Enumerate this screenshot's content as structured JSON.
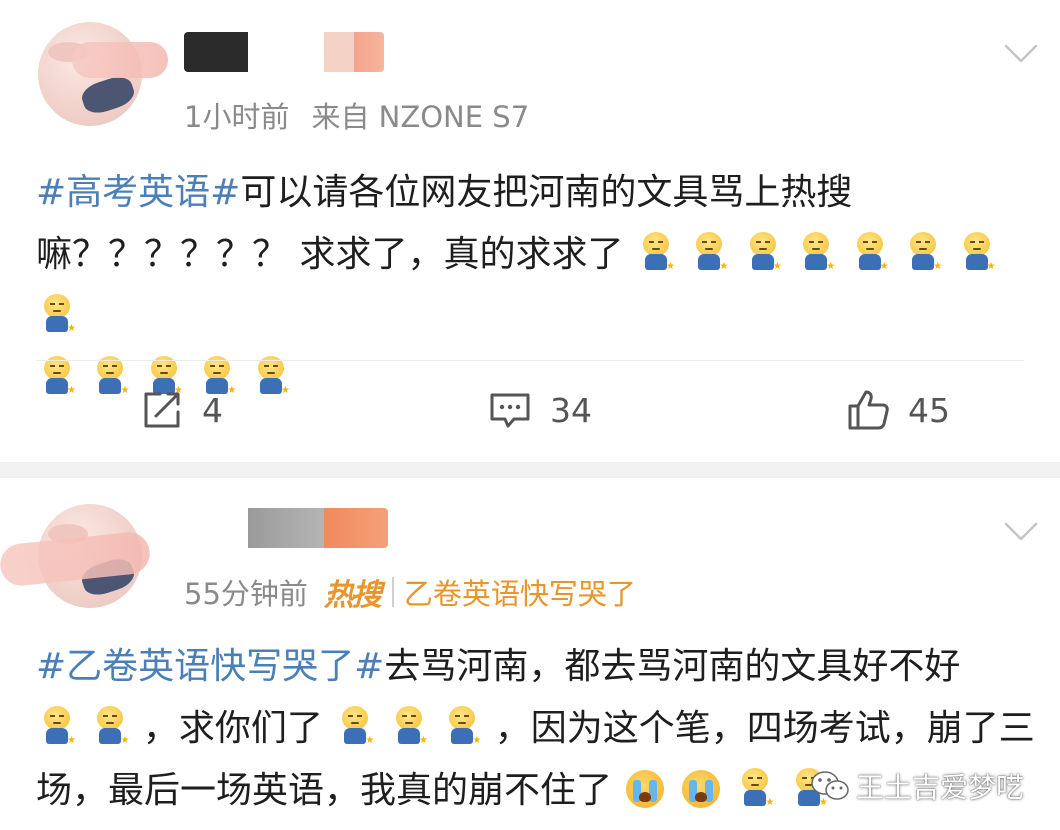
{
  "posts": [
    {
      "time": "1小时前",
      "source": "来自 NZONE S7",
      "topic": "#高考英语#",
      "text_line1": "可以请各位网友把河南的文具骂上热搜",
      "text_line2": "嘛？？？？？？ 求求了，真的求求了",
      "emoji_icon": "sweat-face-emoji",
      "actions": {
        "repost_count": "4",
        "comment_count": "34",
        "like_count": "45"
      }
    },
    {
      "time": "55分钟前",
      "hot_badge": "热搜",
      "hot_topic": "乙卷英语快写哭了",
      "topic": "#乙卷英语快写哭了#",
      "text_line1": "去骂河南，都去骂河南的文具好不好",
      "text_line2": "，求你们了",
      "text_line2b": "，因为这个笔，四场考试，崩了三",
      "text_line3": "场，最后一场英语，我真的崩不住了"
    }
  ],
  "watermark": {
    "label": "王土吉爱梦呓"
  },
  "colors": {
    "topic_link": "#4a7fb8",
    "hot_orange": "#e8952b",
    "meta_gray": "#8a8a8a"
  }
}
